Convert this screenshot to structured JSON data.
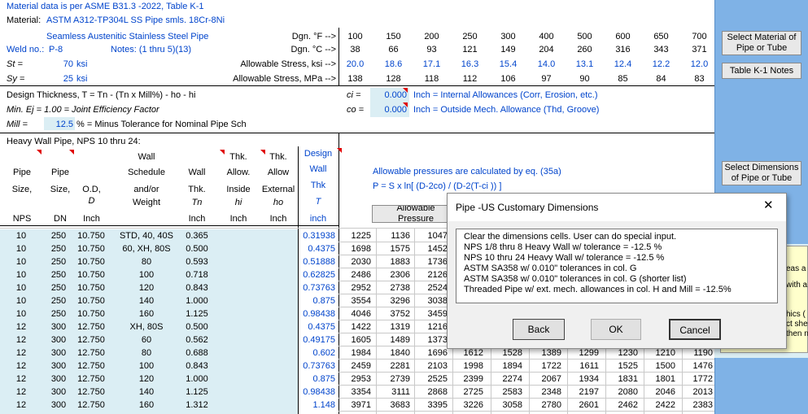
{
  "header": {
    "line1": "Material data is per ASME B31.3 -2022, Table  K-1",
    "material_label": "Material:",
    "material": "ASTM A312-TP304L SS Pipe smls. 18Cr-8Ni",
    "material2": "Seamless Austenitic Stainless Steel Pipe",
    "weld_label": "Weld no.:",
    "weld_value": "P-8",
    "notes": "Notes: (1 thru 5)(13)",
    "st_label": "St =",
    "st_value": "70",
    "st_unit": "ksi",
    "sy_label": "Sy =",
    "sy_value": "25",
    "sy_unit": "ksi"
  },
  "temps": {
    "dgnF_label": "Dgn. °F -->",
    "dgnC_label": "Dgn. °C -->",
    "allow_ksi_label": "Allowable Stress,  ksi -->",
    "allow_mpa_label": "Allowable Stress,  MPa -->",
    "F": [
      "100",
      "150",
      "200",
      "250",
      "300",
      "400",
      "500",
      "600",
      "650",
      "700"
    ],
    "C": [
      "38",
      "66",
      "93",
      "121",
      "149",
      "204",
      "260",
      "316",
      "343",
      "371"
    ],
    "ksi": [
      "20.0",
      "18.6",
      "17.1",
      "16.3",
      "15.4",
      "14.0",
      "13.1",
      "12.4",
      "12.2",
      "12.0"
    ],
    "mpa": [
      "138",
      "128",
      "118",
      "112",
      "106",
      "97",
      "90",
      "85",
      "84",
      "83"
    ]
  },
  "design": {
    "eq": "Design Thickness, T = Tn - (Tn x Mill%) - ho - hi",
    "ej": "Min. Ej = 1.00 = Joint Efficiency Factor",
    "mill_label": "Mill =",
    "mill_value": "12.5",
    "mill_desc": "% = Minus Tolerance for Nominal Pipe Sch",
    "ci_label": "ci =",
    "ci_value": "0.000",
    "ci_desc": "Inch  = Internal Allowances (Corr, Erosion, etc.)",
    "co_label": "co =",
    "co_value": "0.000",
    "co_desc": "Inch  = Outside Mech. Allowance (Thd, Groove)"
  },
  "table": {
    "title": "Heavy Wall Pipe, NPS 10 thru 24:",
    "headers": {
      "pipe_size": [
        "Pipe",
        "Size,",
        "NPS"
      ],
      "pipe_dn": [
        "Pipe",
        "Size,",
        "DN"
      ],
      "od": [
        "O.D,",
        "D",
        "Inch"
      ],
      "wall_sched": [
        "Wall",
        "Schedule",
        "and/or",
        "Weight"
      ],
      "wall": [
        "Wall",
        "Thk.",
        "Tn",
        "Inch"
      ],
      "thk_inside": [
        "Thk.",
        "Allow.",
        "Inside",
        "hi",
        "Inch"
      ],
      "thk_ext": [
        "Thk.",
        "Allow",
        "External",
        "ho",
        "Inch"
      ],
      "design": [
        "Design",
        "Wall",
        "Thk",
        "T",
        "inch"
      ]
    },
    "rows": [
      [
        "10",
        "250",
        "10.750",
        "STD, 40, 40S",
        "0.365",
        "0.31938",
        "1225",
        "1136",
        "1047",
        "",
        "",
        "",
        "",
        "",
        "",
        ""
      ],
      [
        "10",
        "250",
        "10.750",
        "60, XH, 80S",
        "0.500",
        "0.4375",
        "1698",
        "1575",
        "1452",
        "",
        "",
        "",
        "",
        "",
        "",
        ""
      ],
      [
        "10",
        "250",
        "10.750",
        "80",
        "0.593",
        "0.51888",
        "2030",
        "1883",
        "1736",
        "",
        "",
        "",
        "",
        "",
        "",
        ""
      ],
      [
        "10",
        "250",
        "10.750",
        "100",
        "0.718",
        "0.62825",
        "2486",
        "2306",
        "2126",
        "",
        "",
        "",
        "",
        "",
        "",
        ""
      ],
      [
        "10",
        "250",
        "10.750",
        "120",
        "0.843",
        "0.73763",
        "2952",
        "2738",
        "2524",
        "",
        "",
        "",
        "",
        "",
        "",
        ""
      ],
      [
        "10",
        "250",
        "10.750",
        "140",
        "1.000",
        "0.875",
        "3554",
        "3296",
        "3038",
        "",
        "",
        "",
        "",
        "",
        "",
        ""
      ],
      [
        "10",
        "250",
        "10.750",
        "160",
        "1.125",
        "0.98438",
        "4046",
        "3752",
        "3459",
        "",
        "",
        "",
        "",
        "",
        "",
        ""
      ],
      [
        "12",
        "300",
        "12.750",
        "XH, 80S",
        "0.500",
        "0.4375",
        "1422",
        "1319",
        "1216",
        "",
        "",
        "",
        "",
        "",
        "",
        ""
      ],
      [
        "12",
        "300",
        "12.750",
        "60",
        "0.562",
        "0.49175",
        "1605",
        "1489",
        "1373",
        "",
        "",
        "",
        "",
        "",
        "",
        ""
      ],
      [
        "12",
        "300",
        "12.750",
        "80",
        "0.688",
        "0.602",
        "1984",
        "1840",
        "1696",
        "1612",
        "1528",
        "1389",
        "1299",
        "1230",
        "1210",
        "1190"
      ],
      [
        "12",
        "300",
        "12.750",
        "100",
        "0.843",
        "0.73763",
        "2459",
        "2281",
        "2103",
        "1998",
        "1894",
        "1722",
        "1611",
        "1525",
        "1500",
        "1476"
      ],
      [
        "12",
        "300",
        "12.750",
        "120",
        "1.000",
        "0.875",
        "2953",
        "2739",
        "2525",
        "2399",
        "2274",
        "2067",
        "1934",
        "1831",
        "1801",
        "1772"
      ],
      [
        "12",
        "300",
        "12.750",
        "140",
        "1.125",
        "0.98438",
        "3354",
        "3111",
        "2868",
        "2725",
        "2583",
        "2348",
        "2197",
        "2080",
        "2046",
        "2013"
      ],
      [
        "12",
        "300",
        "12.750",
        "160",
        "1.312",
        "1.148",
        "3971",
        "3683",
        "3395",
        "3226",
        "3058",
        "2780",
        "2601",
        "2462",
        "2422",
        "2383"
      ]
    ]
  },
  "info": {
    "line1": "Allowable pressures are calculated by eq. (35a)",
    "line2": "P = S x ln[ (D-2co) / (D-2(T-ci )) ]",
    "allow_press": "Allowable Pressure"
  },
  "buttons": {
    "select_material": "Select Material of Pipe or Tube",
    "table_notes": "Table K-1 Notes",
    "select_dims": "Select Dimensions of Pipe or Tube"
  },
  "side_fragments": [
    "eas a",
    "with a",
    "hics (",
    "ct she",
    "then n"
  ],
  "dialog": {
    "title": "Pipe -US Customary Dimensions",
    "close": "✕",
    "options": [
      "Clear the dimensions cells. User can do special input.",
      "NPS 1/8 thru 8 Heavy Wall w/ tolerance = -12.5 %",
      "NPS 10 thru 24 Heavy Wall w/ tolerance = -12.5 %",
      "ASTM SA358 w/ 0.010\" tolerances in col. G",
      "ASTM SA358 w/ 0.010\" tolerances in col. G (shorter list)",
      "Threaded Pipe w/ ext. mech. allowances in col. H and Mill = -12.5%"
    ],
    "back": "Back",
    "ok": "OK",
    "cancel": "Cancel"
  },
  "colors": {
    "blue_text": "#0044cc",
    "light_blue": "#dbeef4",
    "right_panel": "#7fb2e6",
    "note_yellow": "#ffffcc"
  }
}
